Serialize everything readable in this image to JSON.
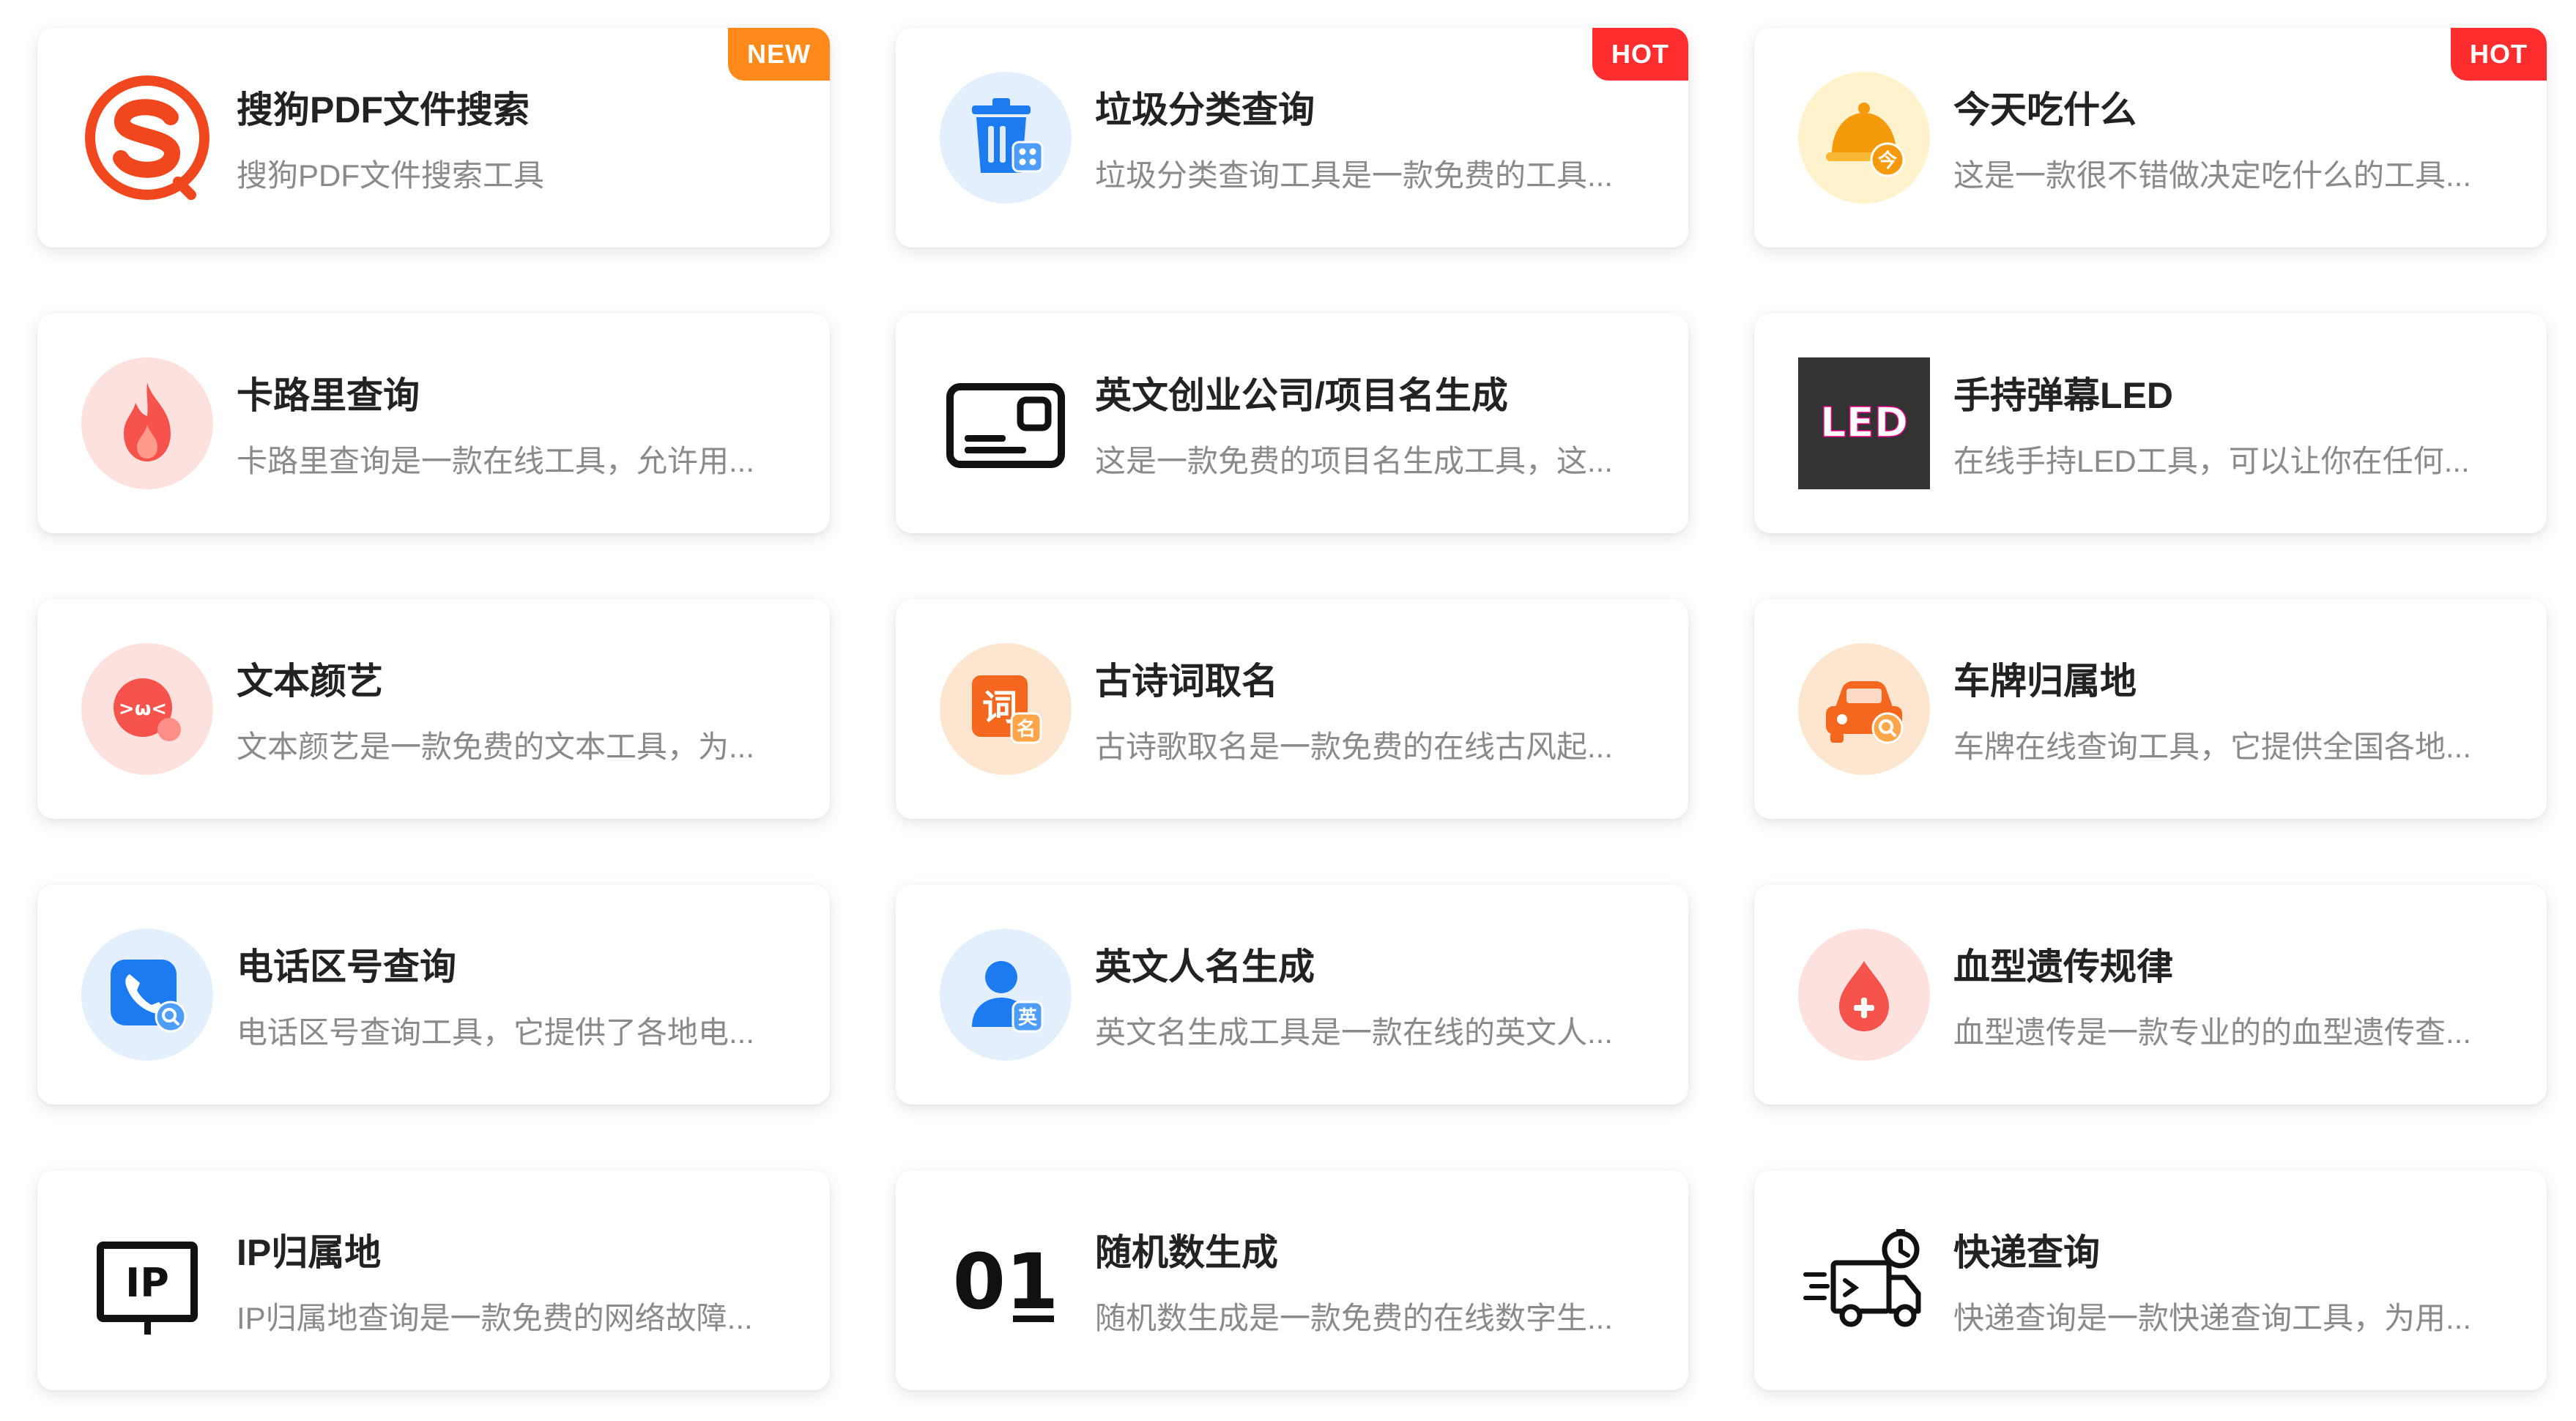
{
  "colors": {
    "badge_new": "#ff8a1c",
    "badge_hot": "#ff2d2d",
    "title": "#222222",
    "desc": "#8a8a8a"
  },
  "tools": [
    {
      "title": "搜狗PDF文件搜索",
      "desc": "搜狗PDF文件搜索工具",
      "badge": "NEW",
      "icon": "sogou-logo-icon"
    },
    {
      "title": "垃圾分类查询",
      "desc": "垃圾分类查询工具是一款免费的工具...",
      "badge": "HOT",
      "icon": "trash-bin-icon"
    },
    {
      "title": "今天吃什么",
      "desc": "这是一款很不错做决定吃什么的工具...",
      "badge": "HOT",
      "icon": "food-cloche-icon"
    },
    {
      "title": "卡路里查询",
      "desc": "卡路里查询是一款在线工具，允许用...",
      "badge": "",
      "icon": "flame-icon"
    },
    {
      "title": "英文创业公司/项目名生成",
      "desc": "这是一款免费的项目名生成工具，这...",
      "badge": "",
      "icon": "id-card-icon"
    },
    {
      "title": "手持弹幕LED",
      "desc": "在线手持LED工具，可以让你在任何...",
      "badge": "",
      "icon": "led-sign-icon",
      "icon_text": "LED"
    },
    {
      "title": "文本颜艺",
      "desc": "文本颜艺是一款免费的文本工具，为...",
      "badge": "",
      "icon": "kaomoji-face-icon",
      "icon_text": ">ω<"
    },
    {
      "title": "古诗词取名",
      "desc": "古诗歌取名是一款免费的在线古风起...",
      "badge": "",
      "icon": "poem-name-icon",
      "icon_text": "词",
      "icon_subtext": "名"
    },
    {
      "title": "车牌归属地",
      "desc": "车牌在线查询工具，它提供全国各地...",
      "badge": "",
      "icon": "car-search-icon"
    },
    {
      "title": "电话区号查询",
      "desc": "电话区号查询工具，它提供了各地电...",
      "badge": "",
      "icon": "phone-search-icon"
    },
    {
      "title": "英文人名生成",
      "desc": "英文名生成工具是一款在线的英文人...",
      "badge": "",
      "icon": "person-english-icon",
      "icon_text": "英"
    },
    {
      "title": "血型遗传规律",
      "desc": "血型遗传是一款专业的的血型遗传查...",
      "badge": "",
      "icon": "blood-drop-icon"
    },
    {
      "title": "IP归属地",
      "desc": "IP归属地查询是一款免费的网络故障...",
      "badge": "",
      "icon": "ip-sign-icon",
      "icon_text": "IP"
    },
    {
      "title": "随机数生成",
      "desc": "随机数生成是一款免费的在线数字生...",
      "badge": "",
      "icon": "random-number-icon",
      "icon_text": "01"
    },
    {
      "title": "快递查询",
      "desc": "快递查询是一款快递查询工具，为用...",
      "badge": "",
      "icon": "delivery-truck-icon"
    }
  ]
}
